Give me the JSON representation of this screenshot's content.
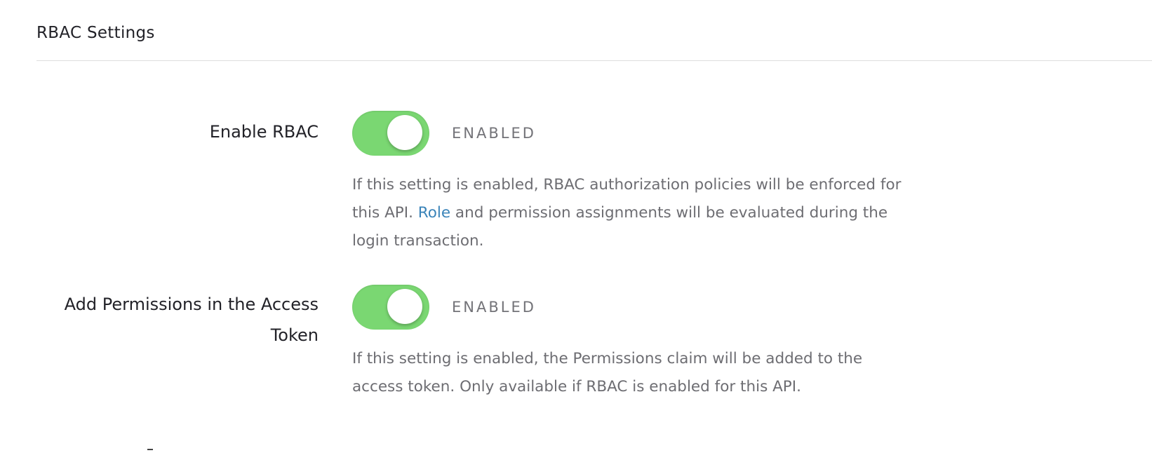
{
  "section": {
    "title": "RBAC Settings"
  },
  "settings": [
    {
      "label": "Enable RBAC",
      "toggle_on": true,
      "status": "ENABLED",
      "description_before": "If this setting is enabled, RBAC authorization policies will be enforced for this API. ",
      "description_link": "Role",
      "description_after": " and permission assignments will be evaluated during the login transaction."
    },
    {
      "label": "Add Permissions in the Access Token",
      "toggle_on": true,
      "status": "ENABLED",
      "description": "If this setting is enabled, the Permissions claim will be added to the access token. Only available if RBAC is enabled for this API."
    }
  ],
  "colors": {
    "toggle_on": "#7ad772",
    "link": "#3b84b9",
    "divider": "#dedede"
  }
}
